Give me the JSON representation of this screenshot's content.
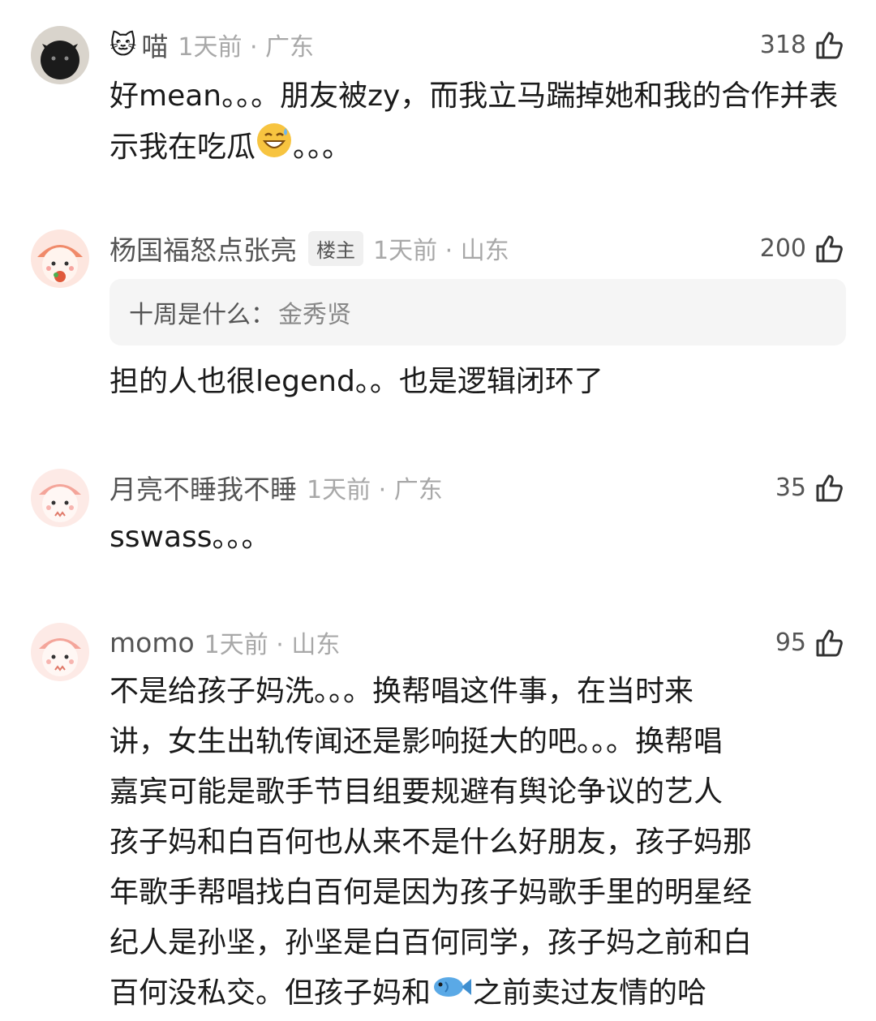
{
  "comments": [
    {
      "username": "喵",
      "prefix_emoji": "cat-face-emoji",
      "meta": "1天前 · 广东",
      "likes": "318",
      "text_part1": "好mean。。。朋友被zy，而我立马踹掉她和我的合作并表示我在吃瓜",
      "inline_emoji": "grinning-sweat-emoji",
      "text_part2": "。。。"
    },
    {
      "username": "杨国福怒点张亮",
      "badge": "楼主",
      "meta": "1天前 · 山东",
      "likes": "200",
      "reply_label": "十周是什么：",
      "reply_text": "金秀贤",
      "text": "担的人也很legend。。也是逻辑闭环了"
    },
    {
      "username": "月亮不睡我不睡",
      "meta": "1天前 · 广东",
      "likes": "35",
      "text": "sswass。。。"
    },
    {
      "username": "momo",
      "meta": "1天前 · 山东",
      "likes": "95",
      "lines": [
        "不是给孩子妈洗。。。换帮唱这件事，在当时来",
        "讲，女生出轨传闻还是影响挺大的吧。。。换帮唱",
        "嘉宾可能是歌手节目组要规避有舆论争议的艺人",
        "孩子妈和白百何也从来不是什么好朋友，孩子妈那",
        "年歌手帮唱找白百何是因为孩子妈歌手里的明星经",
        "纪人是孙坚，孙坚是白百何同学，孩子妈之前和白"
      ],
      "last_line_part1": "百何没私交。但孩子妈和",
      "last_line_emoji": "fish-emoji",
      "last_line_part2": "之前卖过友情的哈"
    }
  ],
  "colors": {
    "username": "#555555",
    "meta": "#a8a8a8",
    "body": "#1a1a1a",
    "reply_bg": "#f5f5f5"
  }
}
